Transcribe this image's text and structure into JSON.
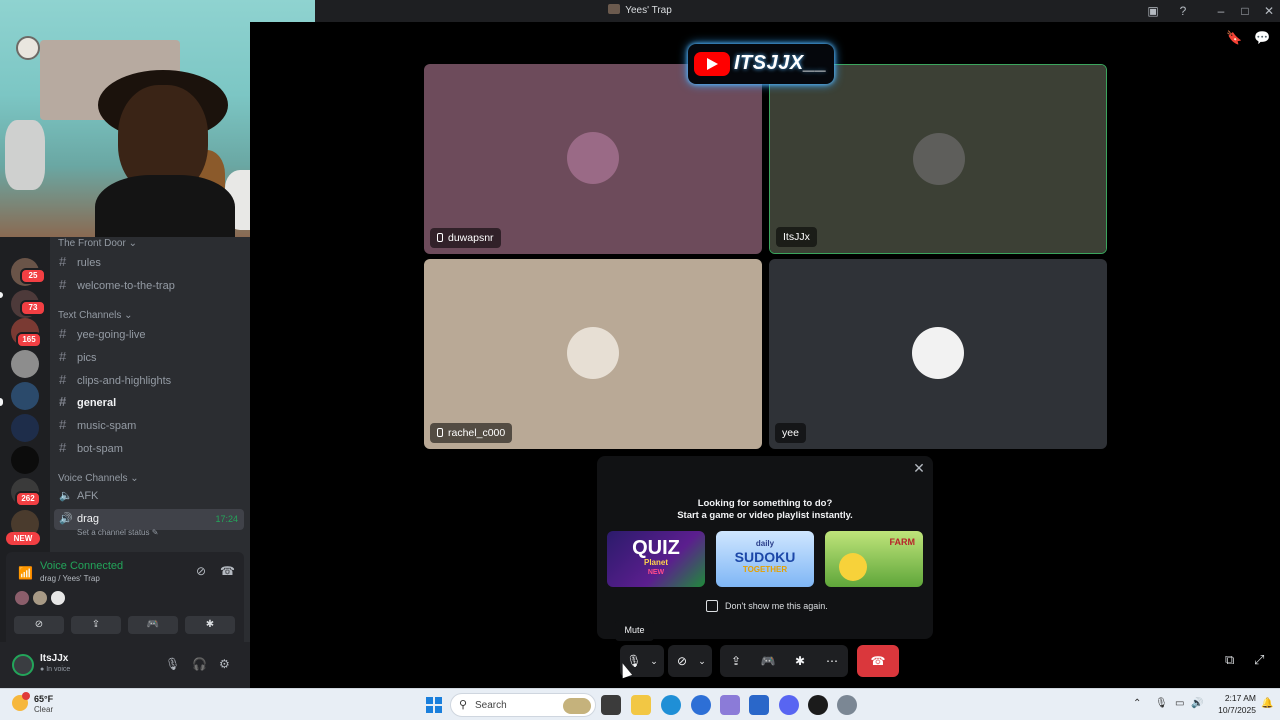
{
  "window": {
    "title": "Yees' Trap"
  },
  "sidebar": {
    "categories": [
      {
        "label": "The Front Door"
      },
      {
        "label": "Text Channels"
      },
      {
        "label": "Voice Channels"
      }
    ],
    "channels": [
      {
        "label": "rules"
      },
      {
        "label": "welcome-to-the-trap"
      },
      {
        "label": "yee-going-live"
      },
      {
        "label": "pics"
      },
      {
        "label": "clips-and-highlights"
      },
      {
        "label": "general"
      },
      {
        "label": "music-spam"
      },
      {
        "label": "bot-spam"
      }
    ],
    "voice_channels": [
      {
        "label": "AFK"
      },
      {
        "label": "drag",
        "timer": "17:24",
        "status": "Set a channel status"
      }
    ],
    "guild_badges": [
      "25",
      "73",
      "165",
      "262"
    ],
    "new_badge": "NEW"
  },
  "voice_panel": {
    "title": "Voice Connected",
    "subtitle": "drag / Yees' Trap"
  },
  "user": {
    "name": "ItsJJx",
    "status": "In voice"
  },
  "overlay": {
    "brand_text": "ITSJJX__"
  },
  "tiles": [
    {
      "name": "duwapsnr",
      "bg": "#6d4b5b"
    },
    {
      "name": "ItsJJx",
      "bg": "#3c4035"
    },
    {
      "name": "rachel_c000",
      "bg": "#b9a996"
    },
    {
      "name": "yee",
      "bg": "#2f3237"
    }
  ],
  "activity": {
    "line1": "Looking for something to do?",
    "line2": "Start a game or video playlist instantly.",
    "games": [
      {
        "title": "QUIZ",
        "subtitle": "Planet",
        "tag": "NEW"
      },
      {
        "title": "SUDOKU",
        "subtitle": "TOGETHER",
        "tag": "daily"
      },
      {
        "title": "FARM",
        "subtitle": "",
        "tag": ""
      }
    ],
    "checkbox_label": "Don't show me this again."
  },
  "controls": {
    "tooltip": "Mute"
  },
  "taskbar": {
    "temp": "65°F",
    "condition": "Clear",
    "search_label": "Search",
    "time": "2:17 AM",
    "date": "10/7/2025"
  },
  "colors": {
    "discord_green": "#23a55a",
    "end_call_red": "#da373c",
    "badge_red": "#f23f43"
  }
}
